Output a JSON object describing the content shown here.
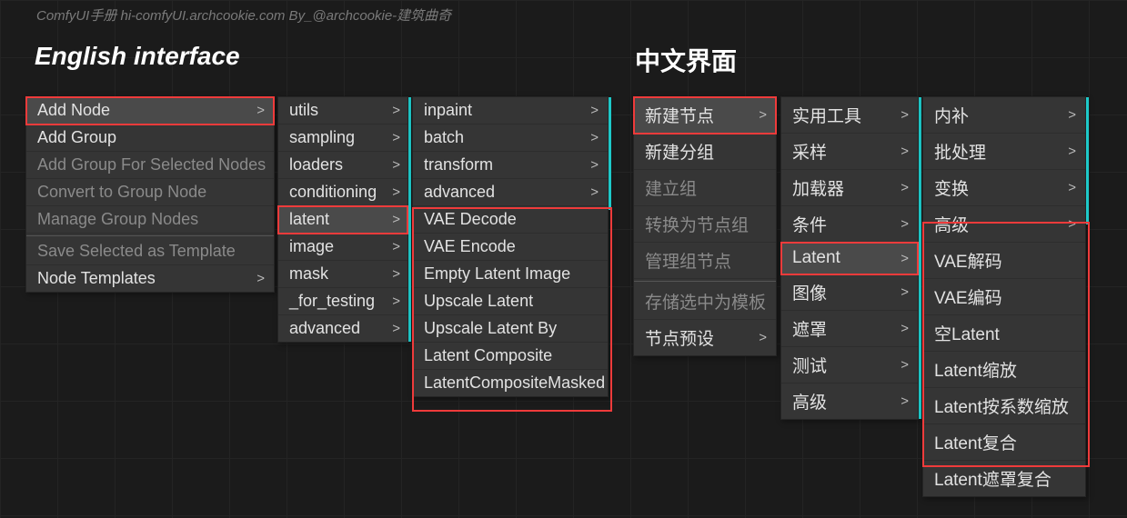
{
  "watermark": "ComfyUI手册 hi-comfyUI.archcookie.com By_@archcookie-建筑曲奇",
  "headings": {
    "en": "English interface",
    "zh": "中文界面"
  },
  "en": {
    "context": [
      {
        "label": "Add Node",
        "sub": true,
        "hl": true
      },
      {
        "label": "Add Group"
      },
      {
        "label": "Add Group For Selected Nodes",
        "dim": true
      },
      {
        "label": "Convert to Group Node",
        "dim": true
      },
      {
        "label": "Manage Group Nodes",
        "dim": true
      },
      {
        "sep": true
      },
      {
        "label": "Save Selected as Template",
        "dim": true
      },
      {
        "label": "Node Templates",
        "sub": true
      }
    ],
    "cats": [
      {
        "label": "utils",
        "sub": true
      },
      {
        "label": "sampling",
        "sub": true
      },
      {
        "label": "loaders",
        "sub": true
      },
      {
        "label": "conditioning",
        "sub": true
      },
      {
        "label": "latent",
        "sub": true,
        "hl": true
      },
      {
        "label": "image",
        "sub": true
      },
      {
        "label": "mask",
        "sub": true
      },
      {
        "label": "_for_testing",
        "sub": true
      },
      {
        "label": "advanced",
        "sub": true
      }
    ],
    "latent": [
      {
        "label": "inpaint",
        "sub": true
      },
      {
        "label": "batch",
        "sub": true
      },
      {
        "label": "transform",
        "sub": true
      },
      {
        "label": "advanced",
        "sub": true
      },
      {
        "label": "VAE Decode"
      },
      {
        "label": "VAE Encode"
      },
      {
        "label": "Empty Latent Image"
      },
      {
        "label": "Upscale Latent"
      },
      {
        "label": "Upscale Latent By"
      },
      {
        "label": "Latent Composite"
      },
      {
        "label": "LatentCompositeMasked"
      }
    ]
  },
  "zh": {
    "context": [
      {
        "label": "新建节点",
        "sub": true,
        "hl": true
      },
      {
        "label": "新建分组"
      },
      {
        "label": "建立组",
        "dim": true
      },
      {
        "label": "转换为节点组",
        "dim": true
      },
      {
        "label": "管理组节点",
        "dim": true
      },
      {
        "sep": true
      },
      {
        "label": "存储选中为模板",
        "dim": true
      },
      {
        "label": "节点预设",
        "sub": true
      }
    ],
    "cats": [
      {
        "label": "实用工具",
        "sub": true
      },
      {
        "label": "采样",
        "sub": true
      },
      {
        "label": "加载器",
        "sub": true
      },
      {
        "label": "条件",
        "sub": true
      },
      {
        "label": "Latent",
        "sub": true,
        "hl": true
      },
      {
        "label": "图像",
        "sub": true
      },
      {
        "label": "遮罩",
        "sub": true
      },
      {
        "label": "测试",
        "sub": true
      },
      {
        "label": "高级",
        "sub": true
      }
    ],
    "latent": [
      {
        "label": "内补",
        "sub": true
      },
      {
        "label": "批处理",
        "sub": true
      },
      {
        "label": "变换",
        "sub": true
      },
      {
        "label": "高级",
        "sub": true
      },
      {
        "label": "VAE解码"
      },
      {
        "label": "VAE编码"
      },
      {
        "label": "空Latent"
      },
      {
        "label": "Latent缩放"
      },
      {
        "label": "Latent按系数缩放"
      },
      {
        "label": "Latent复合"
      },
      {
        "label": "Latent遮罩复合"
      }
    ]
  }
}
